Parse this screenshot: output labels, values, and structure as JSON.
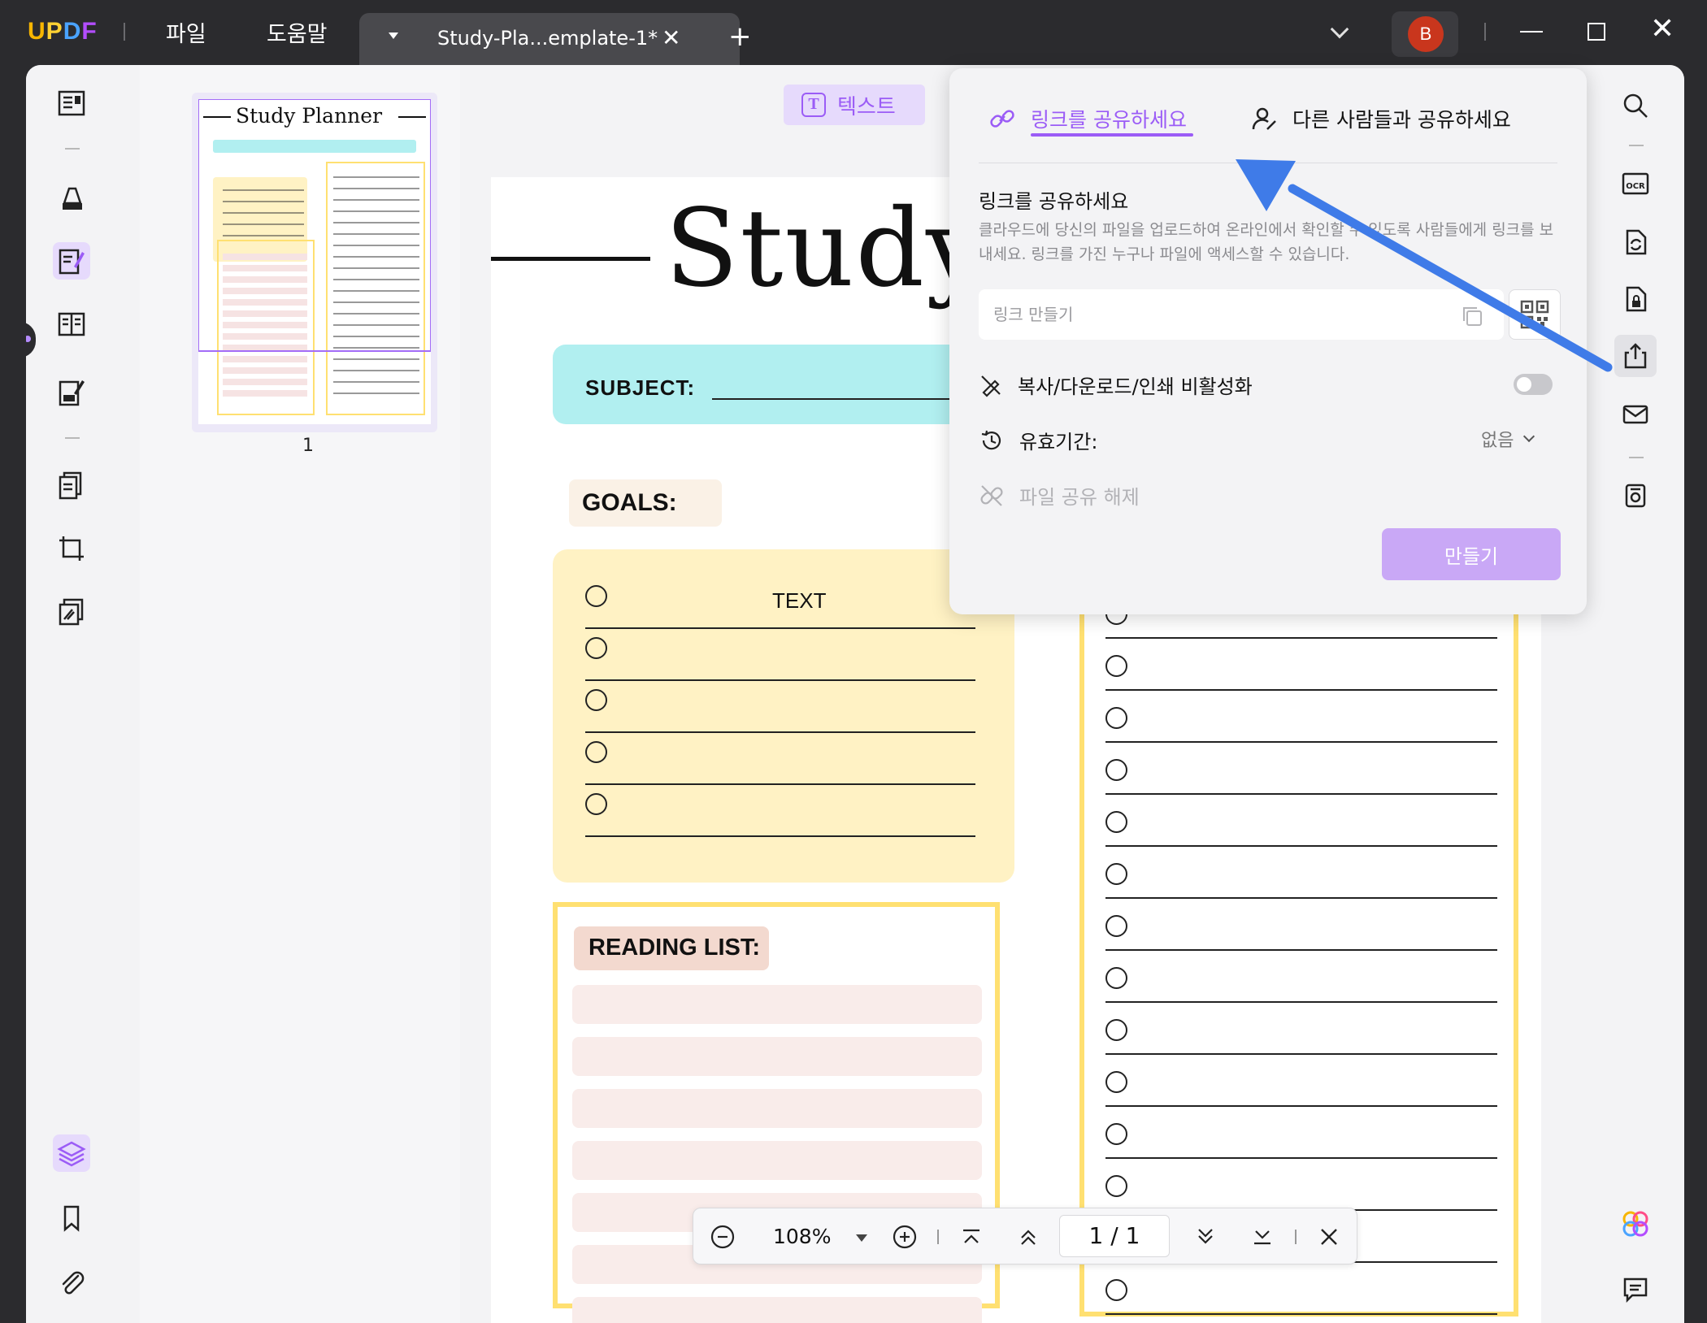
{
  "app": {
    "logo": "UPDF",
    "menu": [
      "파일",
      "도움말"
    ],
    "tab_title": "Study-Pla...emplate-1*",
    "avatar_initial": "B"
  },
  "thumbnail": {
    "page_label": "1",
    "title": "Study Planner"
  },
  "toolbar": {
    "text_mode_label": "텍스트"
  },
  "document": {
    "title": "Study",
    "subject_label": "SUBJECT:",
    "goals_label": "GOALS:",
    "goal_rows": [
      "TEXT",
      "",
      "",
      "",
      ""
    ],
    "reading_list_label": "READING LIST:",
    "reading_bar_count": 7,
    "note_row_count": 14
  },
  "share_popover": {
    "tab_link": "링크를 공유하세요",
    "tab_people": "다른 사람들과 공유하세요",
    "heading": "링크를 공유하세요",
    "description": "클라우드에 당신의 파일을 업로드하여 온라인에서 확인할 수 있도록 사람들에게 링크를 보내세요. 링크를 가진 누구나 파일에 액세스할 수 있습니다.",
    "link_placeholder": "링크 만들기",
    "disable_copy_label": "복사/다운로드/인쇄 비활성화",
    "disable_copy_enabled": false,
    "expiry_label": "유효기간:",
    "expiry_value": "없음",
    "unshare_label": "파일 공유 해제",
    "create_button": "만들기"
  },
  "zoombar": {
    "zoom": "108%",
    "current_page": "1",
    "page_separator": "/",
    "total_pages": "1"
  },
  "colors": {
    "accent": "#9b5cf6",
    "accent_light": "#e6dafc",
    "arrow": "#3f7be8",
    "subject_bg": "#b1eff0",
    "goals_bg": "#fff2c4",
    "reading_border": "#ffe071"
  }
}
